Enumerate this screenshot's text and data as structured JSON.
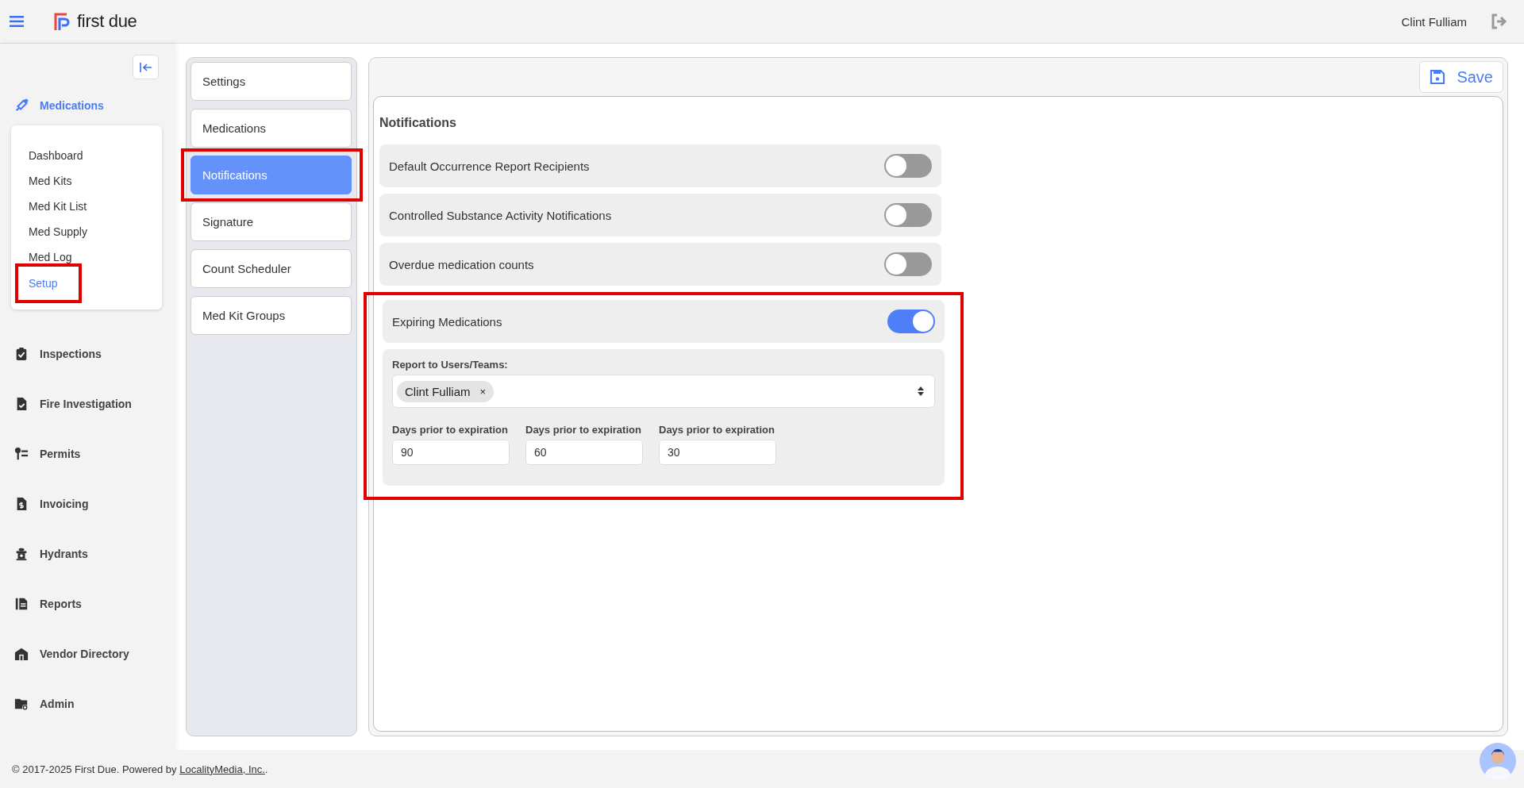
{
  "header": {
    "brand": "first due",
    "user": "Clint Fulliam"
  },
  "sidebar": {
    "section": {
      "label": "Medications",
      "expanded": true,
      "items": [
        {
          "label": "Dashboard",
          "selected": false,
          "highlighted": false
        },
        {
          "label": "Med Kits",
          "selected": false,
          "highlighted": false
        },
        {
          "label": "Med Kit List",
          "selected": false,
          "highlighted": false
        },
        {
          "label": "Med Supply",
          "selected": false,
          "highlighted": false
        },
        {
          "label": "Med Log",
          "selected": false,
          "highlighted": false
        },
        {
          "label": "Setup",
          "selected": true,
          "highlighted": true
        }
      ]
    },
    "items": [
      {
        "label": "Inspections"
      },
      {
        "label": "Fire Investigation"
      },
      {
        "label": "Permits"
      },
      {
        "label": "Invoicing"
      },
      {
        "label": "Hydrants"
      },
      {
        "label": "Reports"
      },
      {
        "label": "Vendor Directory"
      },
      {
        "label": "Admin"
      }
    ]
  },
  "setup_nav": [
    {
      "label": "Settings",
      "selected": false,
      "highlighted": false
    },
    {
      "label": "Medications",
      "selected": false,
      "highlighted": false
    },
    {
      "label": "Notifications",
      "selected": true,
      "highlighted": true
    },
    {
      "label": "Signature",
      "selected": false,
      "highlighted": false
    },
    {
      "label": "Count Scheduler",
      "selected": false,
      "highlighted": false
    },
    {
      "label": "Med Kit Groups",
      "selected": false,
      "highlighted": false
    }
  ],
  "content": {
    "save": "Save",
    "title": "Notifications",
    "toggles": [
      {
        "label": "Default Occurrence Report Recipients",
        "on": false,
        "highlighted": false
      },
      {
        "label": "Controlled Substance Activity Notifications",
        "on": false,
        "highlighted": false
      },
      {
        "label": "Overdue medication counts",
        "on": false,
        "highlighted": false
      },
      {
        "label": "Expiring Medications",
        "on": true,
        "highlighted": true,
        "details": {
          "recipients_label": "Report to Users/Teams:",
          "recipients": [
            {
              "name": "Clint Fulliam",
              "remove": "×"
            }
          ],
          "days": [
            {
              "label": "Days prior to expiration",
              "value": "90"
            },
            {
              "label": "Days prior to expiration",
              "value": "60"
            },
            {
              "label": "Days prior to expiration",
              "value": "30"
            }
          ]
        }
      }
    ]
  },
  "footer": {
    "text": "© 2017-2025 First Due. Powered by ",
    "link": "LocalityMedia, Inc.",
    "end": "."
  }
}
